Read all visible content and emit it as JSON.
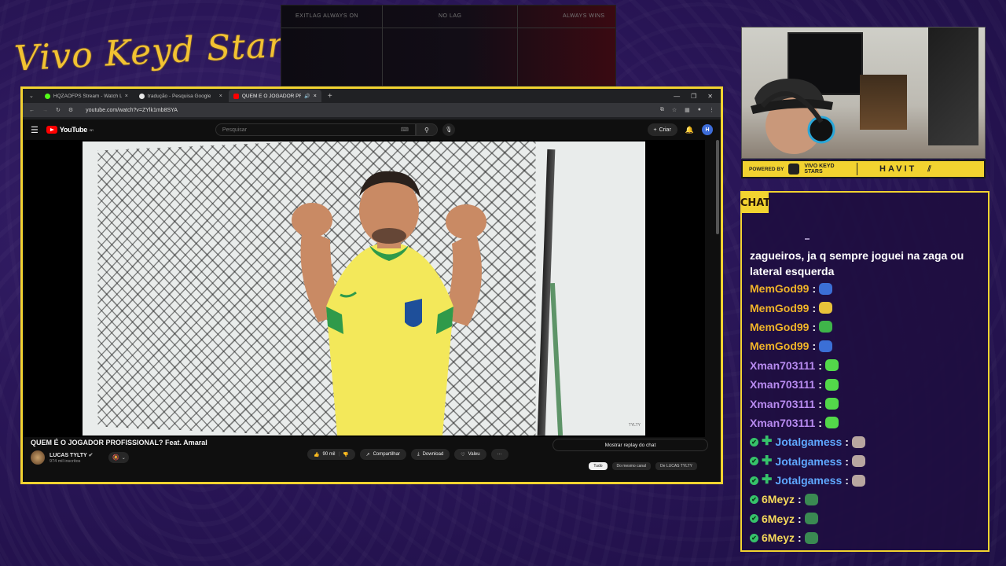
{
  "overlay": {
    "logo_text": "Vivo Keyd Stars",
    "banner": {
      "left_text": "EXITLAG ALWAYS ON",
      "center_text": "NO LAG",
      "right_text": "ALWAYS WINS"
    },
    "sponsor": {
      "powered_by": "POWERED BY",
      "brand_line1": "VIVO KEYD",
      "brand_line2": "STARS",
      "partner": "HAVIT"
    },
    "accent_color": "#f2d330"
  },
  "browser": {
    "tabs": [
      {
        "label": "HQZAOFPS Stream - Watch Liv",
        "favicon_color": "#53fc18",
        "active": false
      },
      {
        "label": "tradução - Pesquisa Google",
        "favicon_color": "#e8e8e8",
        "active": false
      },
      {
        "label": "QUEM É O JOGADOR PROF",
        "favicon_color": "#ff0000",
        "active": true
      }
    ],
    "new_tab": "+",
    "url": "youtube.com/watch?v=ZYlk1mb8SYA"
  },
  "youtube": {
    "logo": "YouTube",
    "logo_country": "BR",
    "search_placeholder": "Pesquisar",
    "create_label": "Criar",
    "avatar_letter": "H",
    "video": {
      "title": "QUEM É O JOGADOR PROFISSIONAL? Feat. Amaral",
      "watermark": "TYLTY",
      "channel_name": "LUCAS TYLTY",
      "channel_subs": "974 mil inscritos",
      "likes": "90 mil",
      "share_label": "Compartilhar",
      "download_label": "Download",
      "thanks_label": "Valeu",
      "more_label": "···",
      "replay_chat": "Mostrar replay do chat",
      "chips": [
        "Tudo",
        "Do mesmo canal",
        "De LUCAS TYLTY"
      ]
    }
  },
  "chat": {
    "tag": "CHAT",
    "partial_message": "zagueiros, ja q sempre joguei na zaga ou lateral esquerda",
    "messages": [
      {
        "user": "MemGod99",
        "color": "#f0b429",
        "emote_color": "#3b6fd6",
        "badges": false
      },
      {
        "user": "MemGod99",
        "color": "#f0b429",
        "emote_color": "#e8c23a",
        "badges": false
      },
      {
        "user": "MemGod99",
        "color": "#f0b429",
        "emote_color": "#3fb54a",
        "badges": false
      },
      {
        "user": "MemGod99",
        "color": "#f0b429",
        "emote_color": "#3b6fd6",
        "badges": false
      },
      {
        "user": "Xman703111",
        "color": "#b88bf0",
        "emote_color": "#53d84a",
        "badges": false
      },
      {
        "user": "Xman703111",
        "color": "#b88bf0",
        "emote_color": "#53d84a",
        "badges": false
      },
      {
        "user": "Xman703111",
        "color": "#b88bf0",
        "emote_color": "#53d84a",
        "badges": false
      },
      {
        "user": "Xman703111",
        "color": "#b88bf0",
        "emote_color": "#53d84a",
        "badges": false
      },
      {
        "user": "Jotalgamess",
        "color": "#5fa8ff",
        "emote_color": "#b8a6a0",
        "badges": true
      },
      {
        "user": "Jotalgamess",
        "color": "#5fa8ff",
        "emote_color": "#b8a6a0",
        "badges": true
      },
      {
        "user": "Jotalgamess",
        "color": "#5fa8ff",
        "emote_color": "#b8a6a0",
        "badges": true
      },
      {
        "user": "6Meyz",
        "color": "#f5d95a",
        "emote_color": "#3a8a52",
        "badges": true
      },
      {
        "user": "6Meyz",
        "color": "#f5d95a",
        "emote_color": "#3a8a52",
        "badges": true
      },
      {
        "user": "6Meyz",
        "color": "#f5d95a",
        "emote_color": "#3a8a52",
        "badges": true
      }
    ]
  }
}
